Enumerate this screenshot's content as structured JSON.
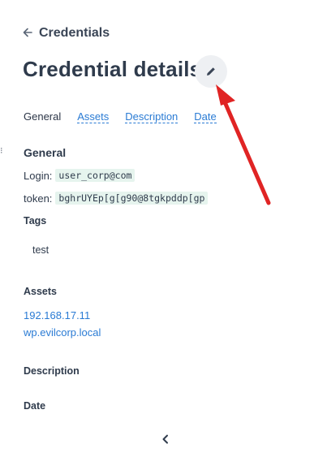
{
  "header": {
    "breadcrumb": "Credentials",
    "back_icon": "arrow-left-icon",
    "title": "Credential details",
    "edit_icon": "pencil-icon"
  },
  "tabs": [
    {
      "label": "General",
      "active": true
    },
    {
      "label": "Assets",
      "active": false
    },
    {
      "label": "Description",
      "active": false
    },
    {
      "label": "Date",
      "active": false
    }
  ],
  "general": {
    "title": "General",
    "login_label": "Login:",
    "login_value": "user_corp@com",
    "token_label": "token:",
    "token_value": "bghrUYEp[g[g90@8tgkpddp[gp"
  },
  "tags": {
    "title": "Tags",
    "items": [
      "test"
    ]
  },
  "assets": {
    "title": "Assets",
    "items": [
      "192.168.17.11",
      "wp.evilcorp.local"
    ]
  },
  "description": {
    "title": "Description"
  },
  "date": {
    "title": "Date"
  },
  "footer": {
    "collapse_icon": "chevron-left-icon"
  },
  "colors": {
    "link": "#2a7bd4",
    "code_bg": "#e6f4ee",
    "annotation_arrow": "#e02424",
    "edit_button_bg": "#eef0f3"
  }
}
